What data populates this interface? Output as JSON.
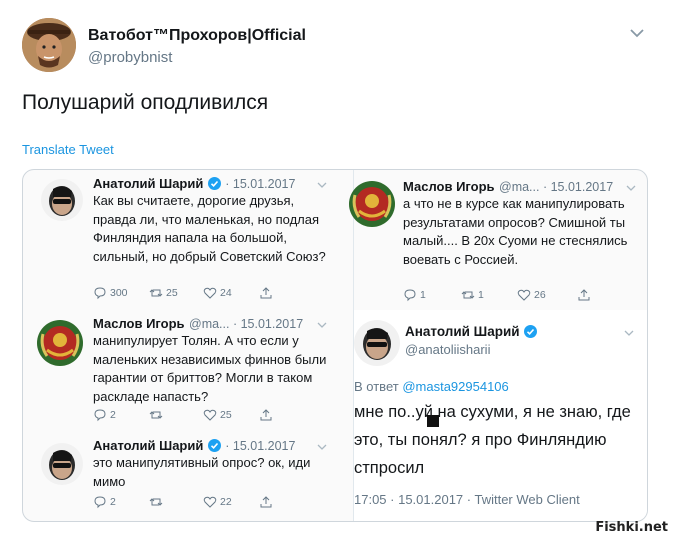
{
  "tweet": {
    "display_name": "Ватобот™Прохоров|Official",
    "handle": "@probybnist",
    "text": "Полушарий оподливился",
    "translate_label": "Translate Tweet"
  },
  "screenshot": {
    "left_column": [
      {
        "name": "Анатолий Шарий",
        "verified": true,
        "meta": "· 15.01.2017",
        "text": "Как вы считаете, дорогие друзья, правда ли, что маленькая, но подлая Финляндия напала на большой, сильный, но добрый Советский Союз?",
        "replies": "300",
        "retweets": "25",
        "likes": "24"
      },
      {
        "name": "Маслов Игорь",
        "verified": false,
        "meta": "@ma... · 15.01.2017",
        "text": "манипулирует Толян. А что если у маленьких независимых финнов были гарантии от бриттов? Могли в таком раскладе напасть?",
        "replies": "2",
        "retweets": "",
        "likes": "25"
      },
      {
        "name": "Анатолий Шарий",
        "verified": true,
        "meta": "· 15.01.2017",
        "text": "это манипулятивный опрос? ок, иди мимо",
        "replies": "2",
        "retweets": "",
        "likes": "22"
      }
    ],
    "right_top": {
      "name": "Маслов Игорь",
      "meta": "@ma... · 15.01.2017",
      "text": "а что не в курсе как манипулировать результатами опросов? Смишной ты малый.... В 20х Суоми не стеснялись воевать с Россией.",
      "replies": "1",
      "retweets": "1",
      "likes": "26"
    },
    "right_big": {
      "name": "Анатолий Шарий",
      "handle": "@anatoliisharii",
      "reply_prefix": "В ответ",
      "reply_handle": "@masta92954106",
      "text": "мне по..уй на сухуми, я не знаю, где это, ты понял? я про Финляндию стпросил",
      "timestamp": "17:05 · 15.01.2017 · Twitter Web Client"
    }
  },
  "watermark": "Fishki.net",
  "colors": {
    "link": "#1b95e0",
    "muted": "#657786",
    "text": "#14171a",
    "verified": "#1da1f2"
  },
  "icons": [
    "chevron-down-icon",
    "verified-icon",
    "reply-icon",
    "retweet-icon",
    "like-icon",
    "share-icon"
  ]
}
